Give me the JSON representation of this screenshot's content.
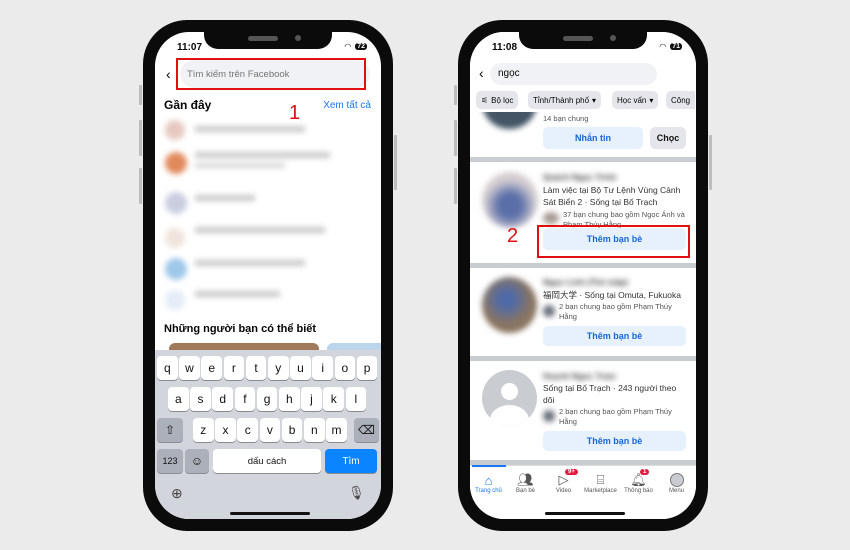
{
  "left_phone": {
    "status": {
      "time": "11:07",
      "battery": "72"
    },
    "search": {
      "placeholder": "Tìm kiếm trên Facebook"
    },
    "recent": {
      "title": "Gần đây",
      "see_all": "Xem tất cả"
    },
    "suggestions_title": "Những người bạn có thể biết",
    "annotation": "1",
    "keyboard": {
      "row1": [
        "q",
        "w",
        "e",
        "r",
        "t",
        "y",
        "u",
        "i",
        "o",
        "p"
      ],
      "row2": [
        "a",
        "s",
        "d",
        "f",
        "g",
        "h",
        "j",
        "k",
        "l"
      ],
      "row3": [
        "z",
        "x",
        "c",
        "v",
        "b",
        "n",
        "m"
      ],
      "numbers": "123",
      "space": "dấu cách",
      "search": "Tìm"
    }
  },
  "right_phone": {
    "status": {
      "time": "11:08",
      "battery": "71"
    },
    "search": {
      "value": "ngọc"
    },
    "filters": [
      "Bộ lọc",
      "Tỉnh/Thành phố",
      "Học vấn",
      "Công"
    ],
    "annotation": "2",
    "results": [
      {
        "mutual": "14 bạn chung",
        "primary": "Nhắn tin",
        "secondary": "Chọc"
      },
      {
        "name": "Quách Ngọc Trinh",
        "info": "Làm việc tại Bộ Tư Lệnh Vùng Cảnh Sát Biển 2 · Sống tại Bố Trạch",
        "mutual": "37 bạn chung bao gồm Ngọc Ánh và Phạm Thúy Hằng",
        "action": "Thêm bạn bè"
      },
      {
        "name": "Ngọc Linh (Thỏ mập)",
        "info": "福岡大学 · Sống tại Omuta, Fukuoka",
        "mutual": "2 bạn chung bao gồm Phạm Thúy Hằng",
        "action": "Thêm bạn bè"
      },
      {
        "name": "Huynh Ngoc Tram",
        "info": "Sống tại Bố Trạch · 243 người theo dõi",
        "mutual": "2 bạn chung bao gồm Phạm Thúy Hằng",
        "action": "Thêm bạn bè"
      }
    ],
    "nav": [
      {
        "label": "Trang chủ",
        "icon": "home-icon",
        "active": true
      },
      {
        "label": "Bạn bè",
        "icon": "friends-icon"
      },
      {
        "label": "Video",
        "icon": "video-icon",
        "badge": "9+"
      },
      {
        "label": "Marketplace",
        "icon": "marketplace-icon"
      },
      {
        "label": "Thông báo",
        "icon": "bell-icon",
        "badge": "1"
      },
      {
        "label": "Menu",
        "icon": "menu-avatar-icon"
      }
    ],
    "accent": "#1877f2"
  }
}
